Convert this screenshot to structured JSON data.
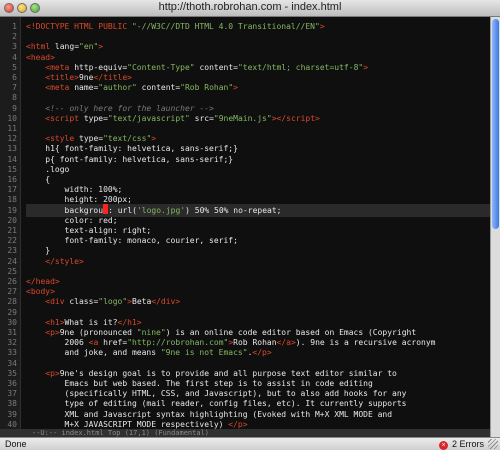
{
  "window": {
    "title": "http://thoth.robrohan.com - index.html"
  },
  "status": {
    "left": "Done",
    "errors": "2 Errors"
  },
  "modeline": "--U:--  index.html   Top (17,1)  (Fundamental)",
  "lines": [
    {
      "n": "1",
      "html": "<span class='t-tag'>&lt;!DOCTYPE HTML PUBLIC </span><span class='t-str'>\"-//W3C//DTD HTML 4.0 Transitional//EN\"</span><span class='t-tag'>&gt;</span>"
    },
    {
      "n": "2",
      "html": ""
    },
    {
      "n": "3",
      "html": "<span class='t-tag'>&lt;html</span> <span class='t-attr'>lang=</span><span class='t-str'>\"en\"</span><span class='t-tag'>&gt;</span>"
    },
    {
      "n": "4",
      "html": "<span class='t-tag'>&lt;head&gt;</span>"
    },
    {
      "n": "5",
      "html": "    <span class='t-tag'>&lt;meta</span> <span class='t-attr'>http-equiv=</span><span class='t-str'>\"Content-Type\"</span> <span class='t-attr'>content=</span><span class='t-str'>\"text/html; charset=utf-8\"</span><span class='t-tag'>&gt;</span>"
    },
    {
      "n": "6",
      "html": "    <span class='t-tag'>&lt;title&gt;</span><span class='t-txt'>9ne</span><span class='t-tag'>&lt;/title&gt;</span>"
    },
    {
      "n": "7",
      "html": "    <span class='t-tag'>&lt;meta</span> <span class='t-attr'>name=</span><span class='t-str'>\"author\"</span> <span class='t-attr'>content=</span><span class='t-str'>\"Rob Rohan\"</span><span class='t-tag'>&gt;</span>"
    },
    {
      "n": "8",
      "html": ""
    },
    {
      "n": "9",
      "html": "    <span class='t-cm'>&lt;!-- only here for the launcher --&gt;</span>"
    },
    {
      "n": "10",
      "html": "    <span class='t-tag'>&lt;script</span> <span class='t-attr'>type=</span><span class='t-str'>\"text/javascript\"</span> <span class='t-attr'>src=</span><span class='t-str'>\"9neMain.js\"</span><span class='t-tag'>&gt;&lt;/script&gt;</span>"
    },
    {
      "n": "11",
      "html": ""
    },
    {
      "n": "12",
      "html": "    <span class='t-tag'>&lt;style</span> <span class='t-attr'>type=</span><span class='t-str'>\"text/css\"</span><span class='t-tag'>&gt;</span>"
    },
    {
      "n": "13",
      "html": "    <span class='t-prop'>h1{ font-family: helvetica, sans-serif;}</span>"
    },
    {
      "n": "14",
      "html": "    <span class='t-prop'>p{ font-family: helvetica, sans-serif;}</span>"
    },
    {
      "n": "15",
      "html": "    <span class='t-prop'>.logo</span>"
    },
    {
      "n": "16",
      "html": "    <span class='t-prop'>{</span>"
    },
    {
      "n": "17",
      "html": "        <span class='t-prop'>width: 100%;</span>"
    },
    {
      "n": "18",
      "html": "        <span class='t-prop'>height: 200px;</span>"
    },
    {
      "n": "19",
      "html": "        <span class='t-prop'>backgrou</span><span class='cursor'></span><span class='t-prop'>: url(</span><span class='t-str'>'logo.jpg'</span><span class='t-prop'>) 50% 50% no-repeat;</span>",
      "hl": true
    },
    {
      "n": "20",
      "html": "        <span class='t-prop'>color: red;</span>"
    },
    {
      "n": "21",
      "html": "        <span class='t-prop'>text-align: right;</span>"
    },
    {
      "n": "22",
      "html": "        <span class='t-prop'>font-family: monaco, courier, serif;</span>"
    },
    {
      "n": "23",
      "html": "    <span class='t-prop'>}</span>"
    },
    {
      "n": "24",
      "html": "    <span class='t-tag'>&lt;/style&gt;</span>"
    },
    {
      "n": "25",
      "html": ""
    },
    {
      "n": "26",
      "html": "<span class='t-tag'>&lt;/head&gt;</span>"
    },
    {
      "n": "27",
      "html": "<span class='t-tag'>&lt;body&gt;</span>"
    },
    {
      "n": "28",
      "html": "    <span class='t-tag'>&lt;div</span> <span class='t-attr'>class=</span><span class='t-str'>\"logo\"</span><span class='t-tag'>&gt;</span><span class='t-txt'>Beta</span><span class='t-tag'>&lt;/div&gt;</span>"
    },
    {
      "n": "29",
      "html": ""
    },
    {
      "n": "30",
      "html": "    <span class='t-tag'>&lt;h1&gt;</span><span class='t-txt'>What is it?</span><span class='t-tag'>&lt;/h1&gt;</span>"
    },
    {
      "n": "31",
      "html": "    <span class='t-tag'>&lt;p&gt;</span><span class='t-txt'>9ne (pronounced </span><span class='t-str'>\"nine\"</span><span class='t-txt'>) is an online code editor based on Emacs (Copyright</span>"
    },
    {
      "n": "32",
      "html": "        <span class='t-txt'>2006 </span><span class='t-tag'>&lt;a</span> <span class='t-attr'>href=</span><span class='t-str'>\"http://robrohan.com\"</span><span class='t-tag'>&gt;</span><span class='t-txt'>Rob Rohan</span><span class='t-tag'>&lt;/a&gt;</span><span class='t-txt'>). 9ne is a recursive acronym</span>"
    },
    {
      "n": "33",
      "html": "        <span class='t-txt'>and joke, and means </span><span class='t-str'>\"9ne is not Emacs\"</span><span class='t-txt'>.</span><span class='t-tag'>&lt;/p&gt;</span>"
    },
    {
      "n": "34",
      "html": ""
    },
    {
      "n": "35",
      "html": "    <span class='t-tag'>&lt;p&gt;</span><span class='t-txt'>9ne's design goal is to provide and all purpose text editor similar to</span>"
    },
    {
      "n": "36",
      "html": "        <span class='t-txt'>Emacs but web based. The first step is to assist in code editing</span>"
    },
    {
      "n": "37",
      "html": "        <span class='t-txt'>(specifically HTML, CSS, and Javascript), but to also add hooks for any</span>"
    },
    {
      "n": "38",
      "html": "        <span class='t-txt'>type of editing (mail reader, config files, etc). It currently supports</span>"
    },
    {
      "n": "39",
      "html": "        <span class='t-txt'>XML and Javascript syntax highlighting (Evoked with M+X XML MODE and</span>"
    },
    {
      "n": "40",
      "html": "        <span class='t-txt'>M+X JAVASCRIPT MODE respectively) </span><span class='t-tag'>&lt;/p&gt;</span>"
    }
  ]
}
